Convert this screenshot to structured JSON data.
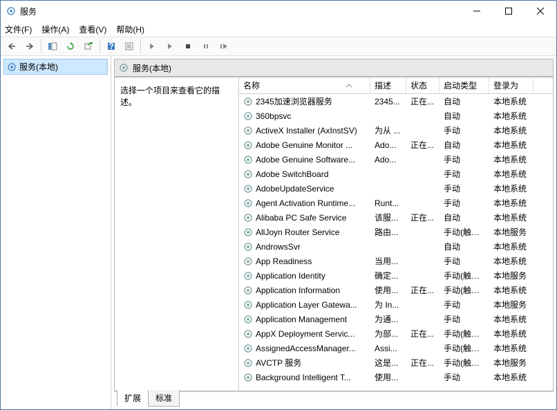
{
  "window": {
    "title": "服务"
  },
  "menu": {
    "file": "文件(F)",
    "action": "操作(A)",
    "view": "查看(V)",
    "help": "帮助(H)"
  },
  "tree": {
    "root": "服务(本地)"
  },
  "pane": {
    "header": "服务(本地)",
    "desc": "选择一个项目来查看它的描述。"
  },
  "columns": {
    "name": "名称",
    "desc": "描述",
    "status": "状态",
    "startup": "启动类型",
    "logon": "登录为"
  },
  "tabs": {
    "extended": "扩展",
    "standard": "标准"
  },
  "services": [
    {
      "name": "2345加速浏览器服务",
      "desc": "2345...",
      "status": "正在...",
      "startup": "自动",
      "logon": "本地系统"
    },
    {
      "name": "360bpsvc",
      "desc": "",
      "status": "",
      "startup": "自动",
      "logon": "本地系统"
    },
    {
      "name": "ActiveX Installer (AxInstSV)",
      "desc": "为从 ...",
      "status": "",
      "startup": "手动",
      "logon": "本地系统"
    },
    {
      "name": "Adobe Genuine Monitor ...",
      "desc": "Ado...",
      "status": "正在...",
      "startup": "自动",
      "logon": "本地系统"
    },
    {
      "name": "Adobe Genuine Software...",
      "desc": "Ado...",
      "status": "",
      "startup": "手动",
      "logon": "本地系统"
    },
    {
      "name": "Adobe SwitchBoard",
      "desc": "",
      "status": "",
      "startup": "手动",
      "logon": "本地系统"
    },
    {
      "name": "AdobeUpdateService",
      "desc": "",
      "status": "",
      "startup": "手动",
      "logon": "本地系统"
    },
    {
      "name": "Agent Activation Runtime...",
      "desc": "Runt...",
      "status": "",
      "startup": "手动",
      "logon": "本地系统"
    },
    {
      "name": "Alibaba PC Safe Service",
      "desc": "该服...",
      "status": "正在...",
      "startup": "自动",
      "logon": "本地系统"
    },
    {
      "name": "AllJoyn Router Service",
      "desc": "路由...",
      "status": "",
      "startup": "手动(触发...",
      "logon": "本地服务"
    },
    {
      "name": "AndrowsSvr",
      "desc": "",
      "status": "",
      "startup": "自动",
      "logon": "本地系统"
    },
    {
      "name": "App Readiness",
      "desc": "当用...",
      "status": "",
      "startup": "手动",
      "logon": "本地系统"
    },
    {
      "name": "Application Identity",
      "desc": "确定...",
      "status": "",
      "startup": "手动(触发...",
      "logon": "本地服务"
    },
    {
      "name": "Application Information",
      "desc": "使用...",
      "status": "正在...",
      "startup": "手动(触发...",
      "logon": "本地系统"
    },
    {
      "name": "Application Layer Gatewa...",
      "desc": "为 In...",
      "status": "",
      "startup": "手动",
      "logon": "本地服务"
    },
    {
      "name": "Application Management",
      "desc": "为通...",
      "status": "",
      "startup": "手动",
      "logon": "本地系统"
    },
    {
      "name": "AppX Deployment Servic...",
      "desc": "为部...",
      "status": "正在...",
      "startup": "手动(触发...",
      "logon": "本地系统"
    },
    {
      "name": "AssignedAccessManager...",
      "desc": "Assi...",
      "status": "",
      "startup": "手动(触发...",
      "logon": "本地系统"
    },
    {
      "name": "AVCTP 服务",
      "desc": "这是...",
      "status": "正在...",
      "startup": "手动(触发...",
      "logon": "本地服务"
    },
    {
      "name": "Background Intelligent T...",
      "desc": "使用...",
      "status": "",
      "startup": "手动",
      "logon": "本地系统"
    }
  ]
}
